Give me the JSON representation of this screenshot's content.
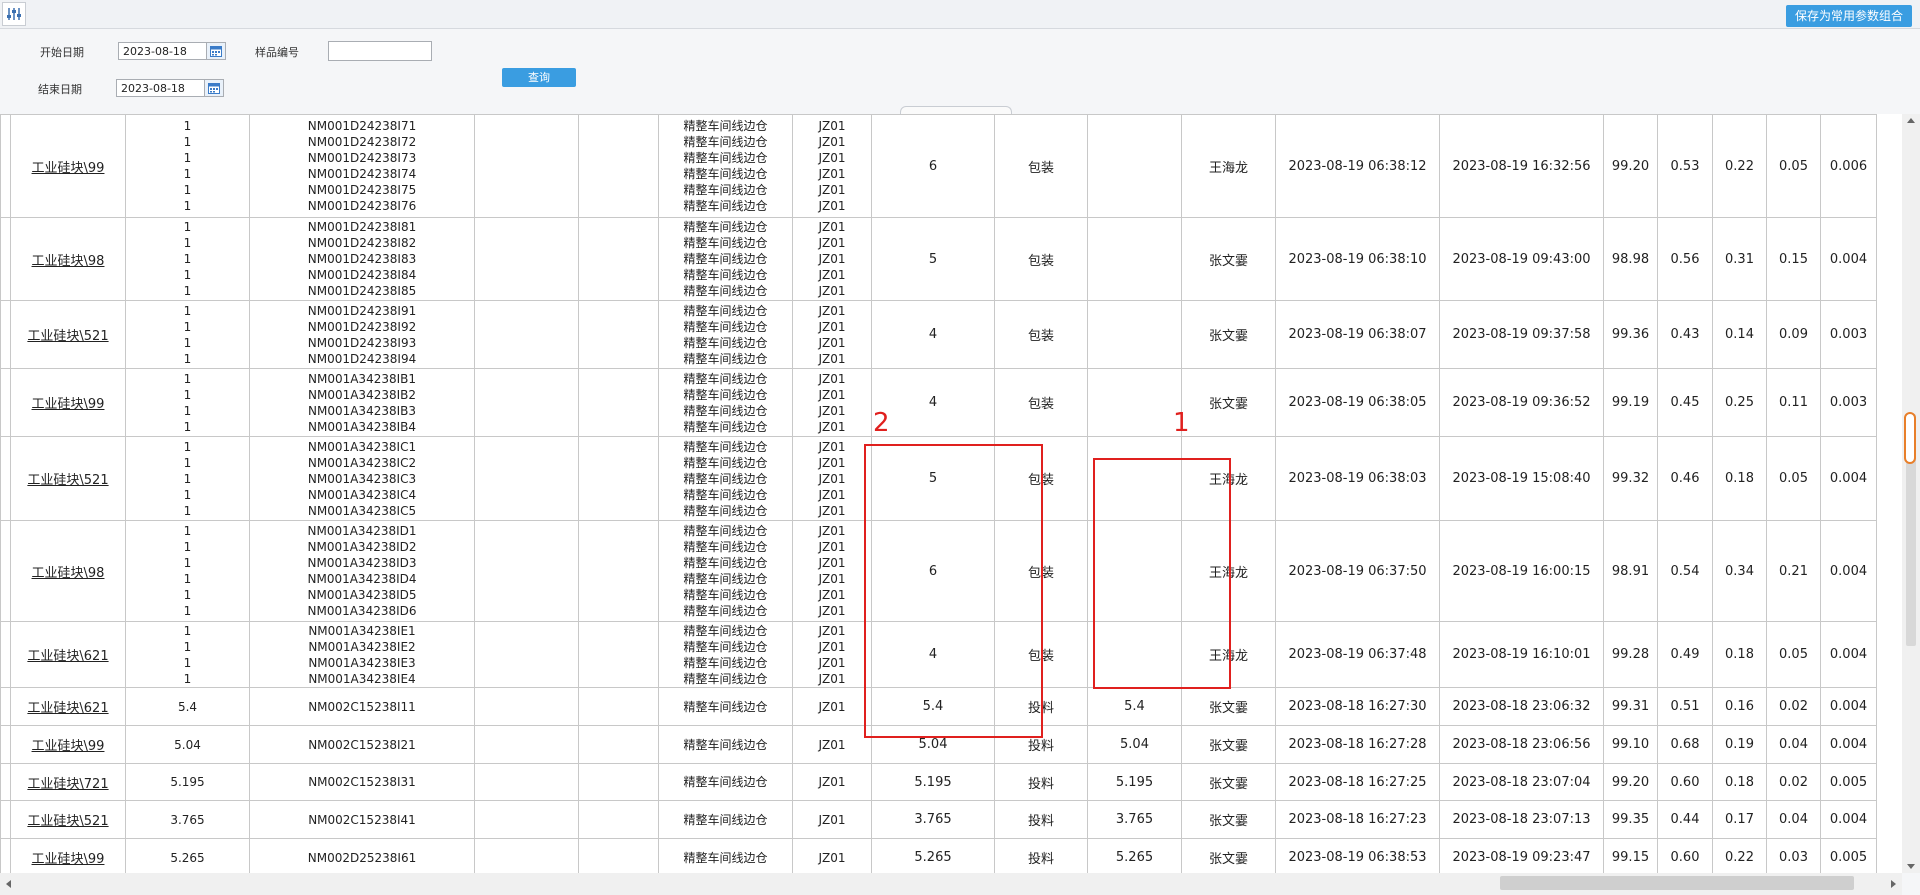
{
  "toolbar": {
    "filter_icon": "sliders-icon",
    "save_combo_label": "保存为常用参数组合"
  },
  "form": {
    "start_date_label": "开始日期",
    "start_date_value": "2023-08-18",
    "end_date_label": "结束日期",
    "end_date_value": "2023-08-18",
    "sample_no_label": "样品编号",
    "sample_no_value": "",
    "query_label": "查询"
  },
  "annotations": {
    "box1_label": "1",
    "box2_label": "2",
    "color": "#e0201e"
  },
  "rows": [
    {
      "product": "工业硅块\\99",
      "qty": [
        "1",
        "1",
        "1",
        "1",
        "1",
        "1"
      ],
      "codes": [
        "NM001D24238I71",
        "NM001D24238I72",
        "NM001D24238I73",
        "NM001D24238I74",
        "NM001D24238I75",
        "NM001D24238I76"
      ],
      "c4": "",
      "c5": "",
      "workshop": [
        "精整车间线边仓",
        "精整车间线边仓",
        "精整车间线边仓",
        "精整车间线边仓",
        "精整车间线边仓",
        "精整车间线边仓"
      ],
      "line": [
        "JZ01",
        "JZ01",
        "JZ01",
        "JZ01",
        "JZ01",
        "JZ01"
      ],
      "count": "6",
      "type": "包装",
      "value": "",
      "person": "王海龙",
      "t1": "2023-08-19 06:38:12",
      "t2": "2023-08-19 16:32:56",
      "v1": "99.20",
      "v2": "0.53",
      "v3": "0.22",
      "v4": "0.05",
      "v5": "0.006"
    },
    {
      "product": "工业硅块\\98",
      "qty": [
        "1",
        "1",
        "1",
        "1",
        "1"
      ],
      "codes": [
        "NM001D24238I81",
        "NM001D24238I82",
        "NM001D24238I83",
        "NM001D24238I84",
        "NM001D24238I85"
      ],
      "c4": "",
      "c5": "",
      "workshop": [
        "精整车间线边仓",
        "精整车间线边仓",
        "精整车间线边仓",
        "精整车间线边仓",
        "精整车间线边仓"
      ],
      "line": [
        "JZ01",
        "JZ01",
        "JZ01",
        "JZ01",
        "JZ01"
      ],
      "count": "5",
      "type": "包装",
      "value": "",
      "person": "张文霎",
      "t1": "2023-08-19 06:38:10",
      "t2": "2023-08-19 09:43:00",
      "v1": "98.98",
      "v2": "0.56",
      "v3": "0.31",
      "v4": "0.15",
      "v5": "0.004"
    },
    {
      "product": "工业硅块\\521",
      "qty": [
        "1",
        "1",
        "1",
        "1"
      ],
      "codes": [
        "NM001D24238I91",
        "NM001D24238I92",
        "NM001D24238I93",
        "NM001D24238I94"
      ],
      "c4": "",
      "c5": "",
      "workshop": [
        "精整车间线边仓",
        "精整车间线边仓",
        "精整车间线边仓",
        "精整车间线边仓"
      ],
      "line": [
        "JZ01",
        "JZ01",
        "JZ01",
        "JZ01"
      ],
      "count": "4",
      "type": "包装",
      "value": "",
      "person": "张文霎",
      "t1": "2023-08-19 06:38:07",
      "t2": "2023-08-19 09:37:58",
      "v1": "99.36",
      "v2": "0.43",
      "v3": "0.14",
      "v4": "0.09",
      "v5": "0.003"
    },
    {
      "product": "工业硅块\\99",
      "qty": [
        "1",
        "1",
        "1",
        "1"
      ],
      "codes": [
        "NM001A34238IB1",
        "NM001A34238IB2",
        "NM001A34238IB3",
        "NM001A34238IB4"
      ],
      "c4": "",
      "c5": "",
      "workshop": [
        "精整车间线边仓",
        "精整车间线边仓",
        "精整车间线边仓",
        "精整车间线边仓"
      ],
      "line": [
        "JZ01",
        "JZ01",
        "JZ01",
        "JZ01"
      ],
      "count": "4",
      "type": "包装",
      "value": "",
      "person": "张文霎",
      "t1": "2023-08-19 06:38:05",
      "t2": "2023-08-19 09:36:52",
      "v1": "99.19",
      "v2": "0.45",
      "v3": "0.25",
      "v4": "0.11",
      "v5": "0.003"
    },
    {
      "product": "工业硅块\\521",
      "qty": [
        "1",
        "1",
        "1",
        "1",
        "1"
      ],
      "codes": [
        "NM001A34238IC1",
        "NM001A34238IC2",
        "NM001A34238IC3",
        "NM001A34238IC4",
        "NM001A34238IC5"
      ],
      "c4": "",
      "c5": "",
      "workshop": [
        "精整车间线边仓",
        "精整车间线边仓",
        "精整车间线边仓",
        "精整车间线边仓",
        "精整车间线边仓"
      ],
      "line": [
        "JZ01",
        "JZ01",
        "JZ01",
        "JZ01",
        "JZ01"
      ],
      "count": "5",
      "type": "包装",
      "value": "",
      "person": "王海龙",
      "t1": "2023-08-19 06:38:03",
      "t2": "2023-08-19 15:08:40",
      "v1": "99.32",
      "v2": "0.46",
      "v3": "0.18",
      "v4": "0.05",
      "v5": "0.004"
    },
    {
      "product": "工业硅块\\98",
      "qty": [
        "1",
        "1",
        "1",
        "1",
        "1",
        "1"
      ],
      "codes": [
        "NM001A34238ID1",
        "NM001A34238ID2",
        "NM001A34238ID3",
        "NM001A34238ID4",
        "NM001A34238ID5",
        "NM001A34238ID6"
      ],
      "c4": "",
      "c5": "",
      "workshop": [
        "精整车间线边仓",
        "精整车间线边仓",
        "精整车间线边仓",
        "精整车间线边仓",
        "精整车间线边仓",
        "精整车间线边仓"
      ],
      "line": [
        "JZ01",
        "JZ01",
        "JZ01",
        "JZ01",
        "JZ01",
        "JZ01"
      ],
      "count": "6",
      "type": "包装",
      "value": "",
      "person": "王海龙",
      "t1": "2023-08-19 06:37:50",
      "t2": "2023-08-19 16:00:15",
      "v1": "98.91",
      "v2": "0.54",
      "v3": "0.34",
      "v4": "0.21",
      "v5": "0.004"
    },
    {
      "product": "工业硅块\\621",
      "qty": [
        "1",
        "1",
        "1",
        "1"
      ],
      "codes": [
        "NM001A34238IE1",
        "NM001A34238IE2",
        "NM001A34238IE3",
        "NM001A34238IE4"
      ],
      "c4": "",
      "c5": "",
      "workshop": [
        "精整车间线边仓",
        "精整车间线边仓",
        "精整车间线边仓",
        "精整车间线边仓"
      ],
      "line": [
        "JZ01",
        "JZ01",
        "JZ01",
        "JZ01"
      ],
      "count": "4",
      "type": "包装",
      "value": "",
      "person": "王海龙",
      "t1": "2023-08-19 06:37:48",
      "t2": "2023-08-19 16:10:01",
      "v1": "99.28",
      "v2": "0.49",
      "v3": "0.18",
      "v4": "0.05",
      "v5": "0.004"
    },
    {
      "product": "工业硅块\\621",
      "qty": [
        "5.4"
      ],
      "codes": [
        "NM002C15238I11"
      ],
      "c4": "",
      "c5": "",
      "workshop": [
        "精整车间线边仓"
      ],
      "line": [
        "JZ01"
      ],
      "count": "5.4",
      "type": "投料",
      "value": "5.4",
      "person": "张文霎",
      "t1": "2023-08-18 16:27:30",
      "t2": "2023-08-18 23:06:32",
      "v1": "99.31",
      "v2": "0.51",
      "v3": "0.16",
      "v4": "0.02",
      "v5": "0.004"
    },
    {
      "product": "工业硅块\\99",
      "qty": [
        "5.04"
      ],
      "codes": [
        "NM002C15238I21"
      ],
      "c4": "",
      "c5": "",
      "workshop": [
        "精整车间线边仓"
      ],
      "line": [
        "JZ01"
      ],
      "count": "5.04",
      "type": "投料",
      "value": "5.04",
      "person": "张文霎",
      "t1": "2023-08-18 16:27:28",
      "t2": "2023-08-18 23:06:56",
      "v1": "99.10",
      "v2": "0.68",
      "v3": "0.19",
      "v4": "0.04",
      "v5": "0.004"
    },
    {
      "product": "工业硅块\\721",
      "qty": [
        "5.195"
      ],
      "codes": [
        "NM002C15238I31"
      ],
      "c4": "",
      "c5": "",
      "workshop": [
        "精整车间线边仓"
      ],
      "line": [
        "JZ01"
      ],
      "count": "5.195",
      "type": "投料",
      "value": "5.195",
      "person": "张文霎",
      "t1": "2023-08-18 16:27:25",
      "t2": "2023-08-18 23:07:04",
      "v1": "99.20",
      "v2": "0.60",
      "v3": "0.18",
      "v4": "0.02",
      "v5": "0.005"
    },
    {
      "product": "工业硅块\\521",
      "qty": [
        "3.765"
      ],
      "codes": [
        "NM002C15238I41"
      ],
      "c4": "",
      "c5": "",
      "workshop": [
        "精整车间线边仓"
      ],
      "line": [
        "JZ01"
      ],
      "count": "3.765",
      "type": "投料",
      "value": "3.765",
      "person": "张文霎",
      "t1": "2023-08-18 16:27:23",
      "t2": "2023-08-18 23:07:13",
      "v1": "99.35",
      "v2": "0.44",
      "v3": "0.17",
      "v4": "0.04",
      "v5": "0.004"
    },
    {
      "product": "工业硅块\\99",
      "qty": [
        "5.265"
      ],
      "codes": [
        "NM002D25238I61"
      ],
      "c4": "",
      "c5": "",
      "workshop": [
        "精整车间线边仓"
      ],
      "line": [
        "JZ01"
      ],
      "count": "5.265",
      "type": "投料",
      "value": "5.265",
      "person": "张文霎",
      "t1": "2023-08-19 06:38:53",
      "t2": "2023-08-19 09:23:47",
      "v1": "99.15",
      "v2": "0.60",
      "v3": "0.22",
      "v4": "0.03",
      "v5": "0.005"
    }
  ]
}
